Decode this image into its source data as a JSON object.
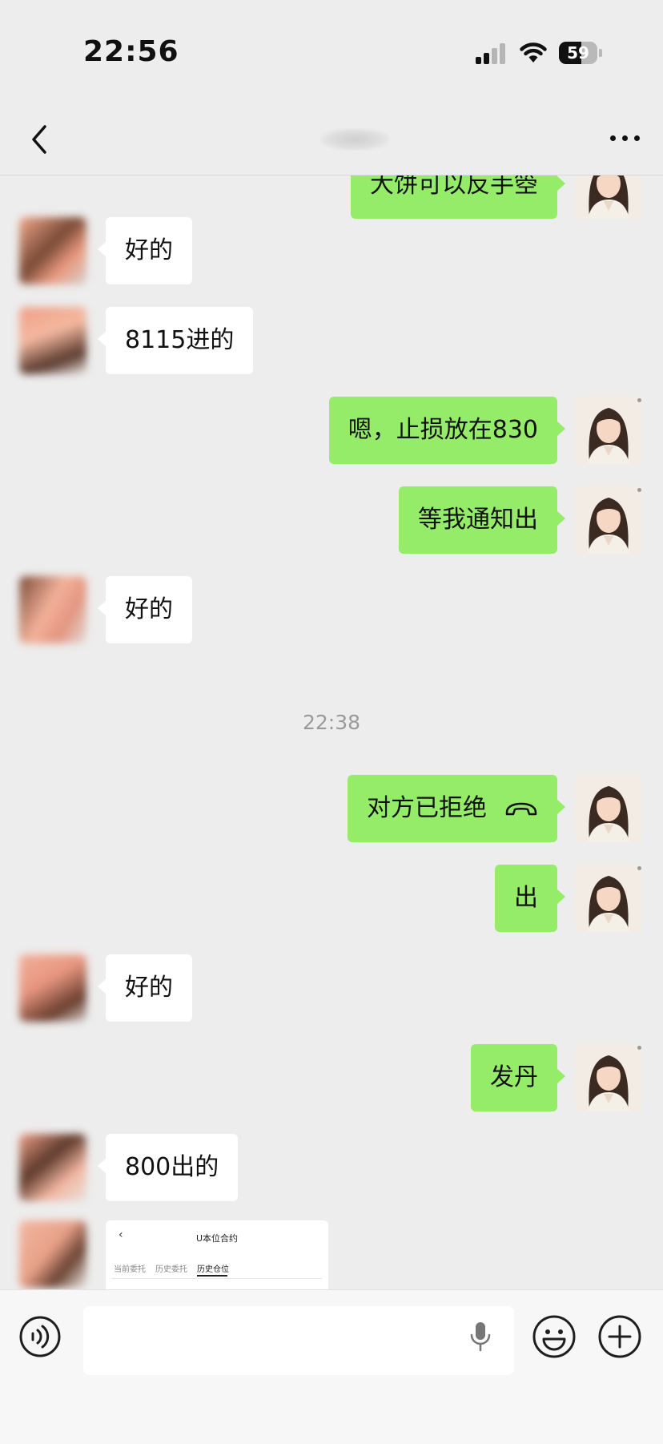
{
  "status_bar": {
    "time": "22:56",
    "battery": "59",
    "battery_level": 0.59
  },
  "nav": {
    "title": ""
  },
  "messages": [
    {
      "side": "self",
      "text": "大饼可以反手箜"
    },
    {
      "side": "other",
      "text": "好的"
    },
    {
      "side": "other",
      "text": "8115进的"
    },
    {
      "side": "self",
      "text": "嗯，止损放在830"
    },
    {
      "side": "self",
      "text": "等我通知出"
    },
    {
      "side": "other",
      "text": "好的"
    },
    {
      "side": "time",
      "text": "22:38"
    },
    {
      "side": "self",
      "text": "对方已拒绝",
      "icon": "phone-hangup-icon"
    },
    {
      "side": "self",
      "text": "出"
    },
    {
      "side": "other",
      "text": "好的"
    },
    {
      "side": "self",
      "text": "发丹"
    },
    {
      "side": "other",
      "text": "800出的"
    }
  ],
  "shared_screenshot": {
    "title": "U本位合约",
    "tabs": [
      "当前委托",
      "历史委托",
      "历史仓位"
    ],
    "active_tab": "历史仓位"
  },
  "input": {
    "value": "",
    "placeholder": ""
  },
  "colors": {
    "background": "#ededed",
    "self_bubble": "#95ec69",
    "other_bubble": "#ffffff",
    "timestamp": "#9a9a9a"
  },
  "icons": [
    "back-icon",
    "more-icon",
    "voice-icon",
    "mic-icon",
    "emoji-icon",
    "plus-icon",
    "phone-hangup-icon",
    "wifi-icon",
    "signal-icon",
    "battery-icon"
  ]
}
